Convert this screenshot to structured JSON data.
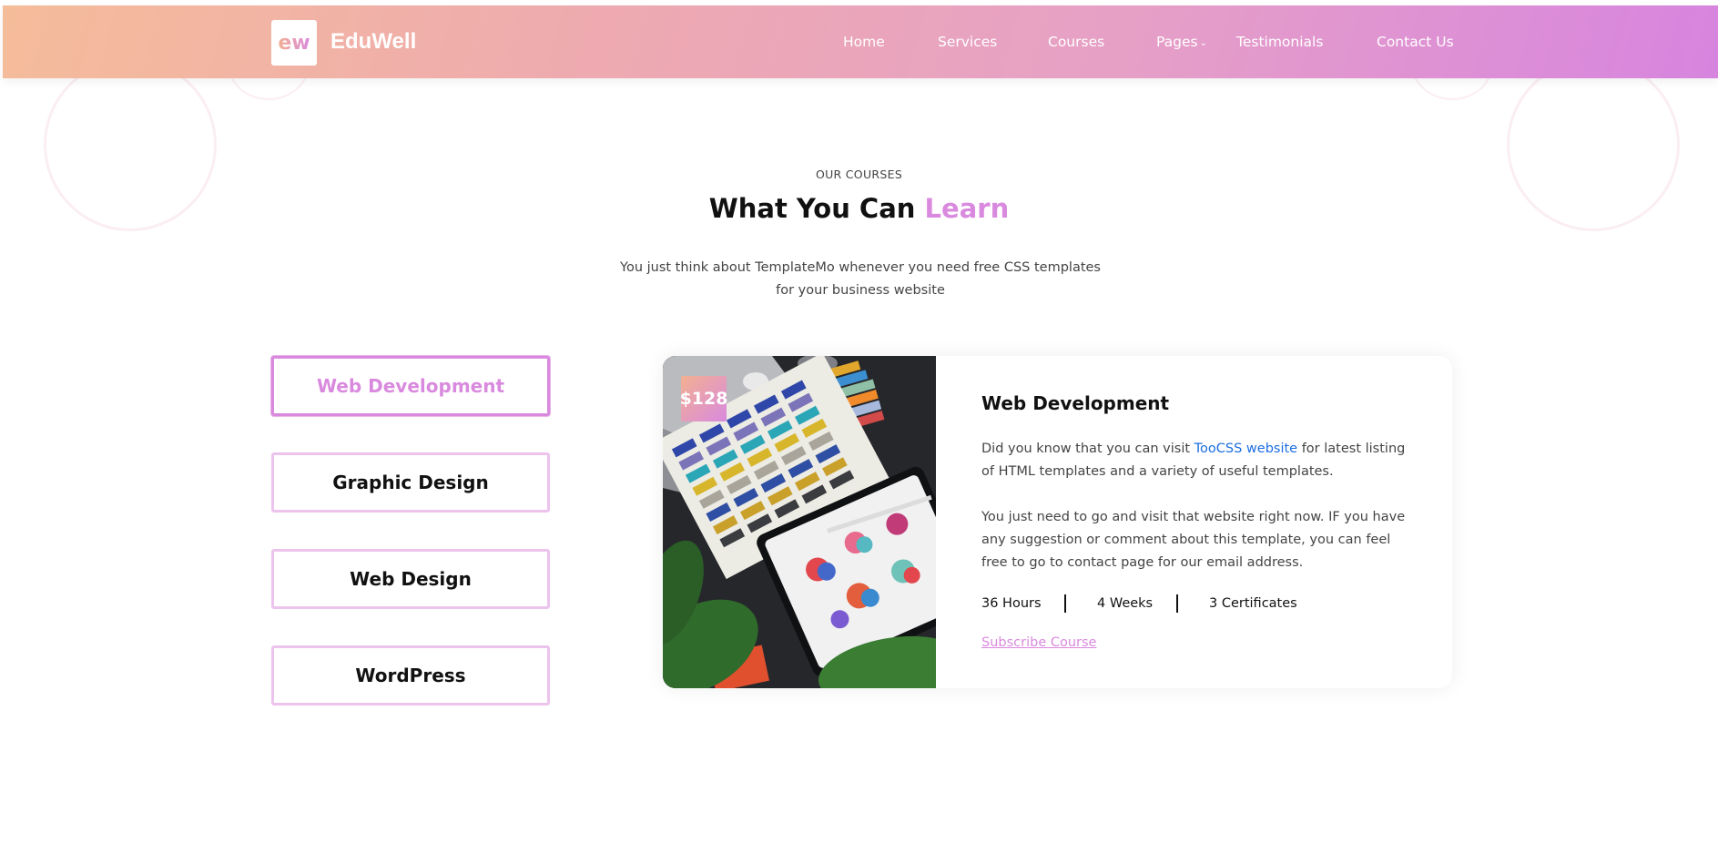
{
  "header": {
    "logo_text": "ew",
    "brand": "EduWell",
    "nav": [
      {
        "label": "Home"
      },
      {
        "label": "Services"
      },
      {
        "label": "Courses"
      },
      {
        "label": "Pages",
        "icon": "chevron-down-icon"
      },
      {
        "label": "Testimonials"
      },
      {
        "label": "Contact Us"
      }
    ]
  },
  "section": {
    "eyebrow": "OUR COURSES",
    "title_main": "What You Can",
    "title_accent": "Learn",
    "subtitle": "You just think about TemplateMo whenever you need free CSS templates for your business website"
  },
  "tabs": [
    {
      "label": "Web Development",
      "active": true
    },
    {
      "label": "Graphic Design",
      "active": false
    },
    {
      "label": "Web Design",
      "active": false
    },
    {
      "label": "WordPress",
      "active": false
    }
  ],
  "course": {
    "price": "$128",
    "title": "Web Development",
    "p1_before": "Did you know that you can visit ",
    "p1_link": "TooCSS website",
    "p1_after": " for latest listing of HTML templates and a variety of useful templates.",
    "p2": "You just need to go and visit that website right now. IF you have any suggestion or comment about this template, you can feel free to go to contact page for our email address.",
    "meta": {
      "hours": "36 Hours",
      "weeks": "4 Weeks",
      "certificates": "3 Certificates"
    },
    "subscribe": "Subscribe Course"
  },
  "colors": {
    "accent": "#d98ade",
    "link": "#1c6ee0",
    "header_gradient_start": "#f5bc9a",
    "header_gradient_end": "#d784df"
  }
}
